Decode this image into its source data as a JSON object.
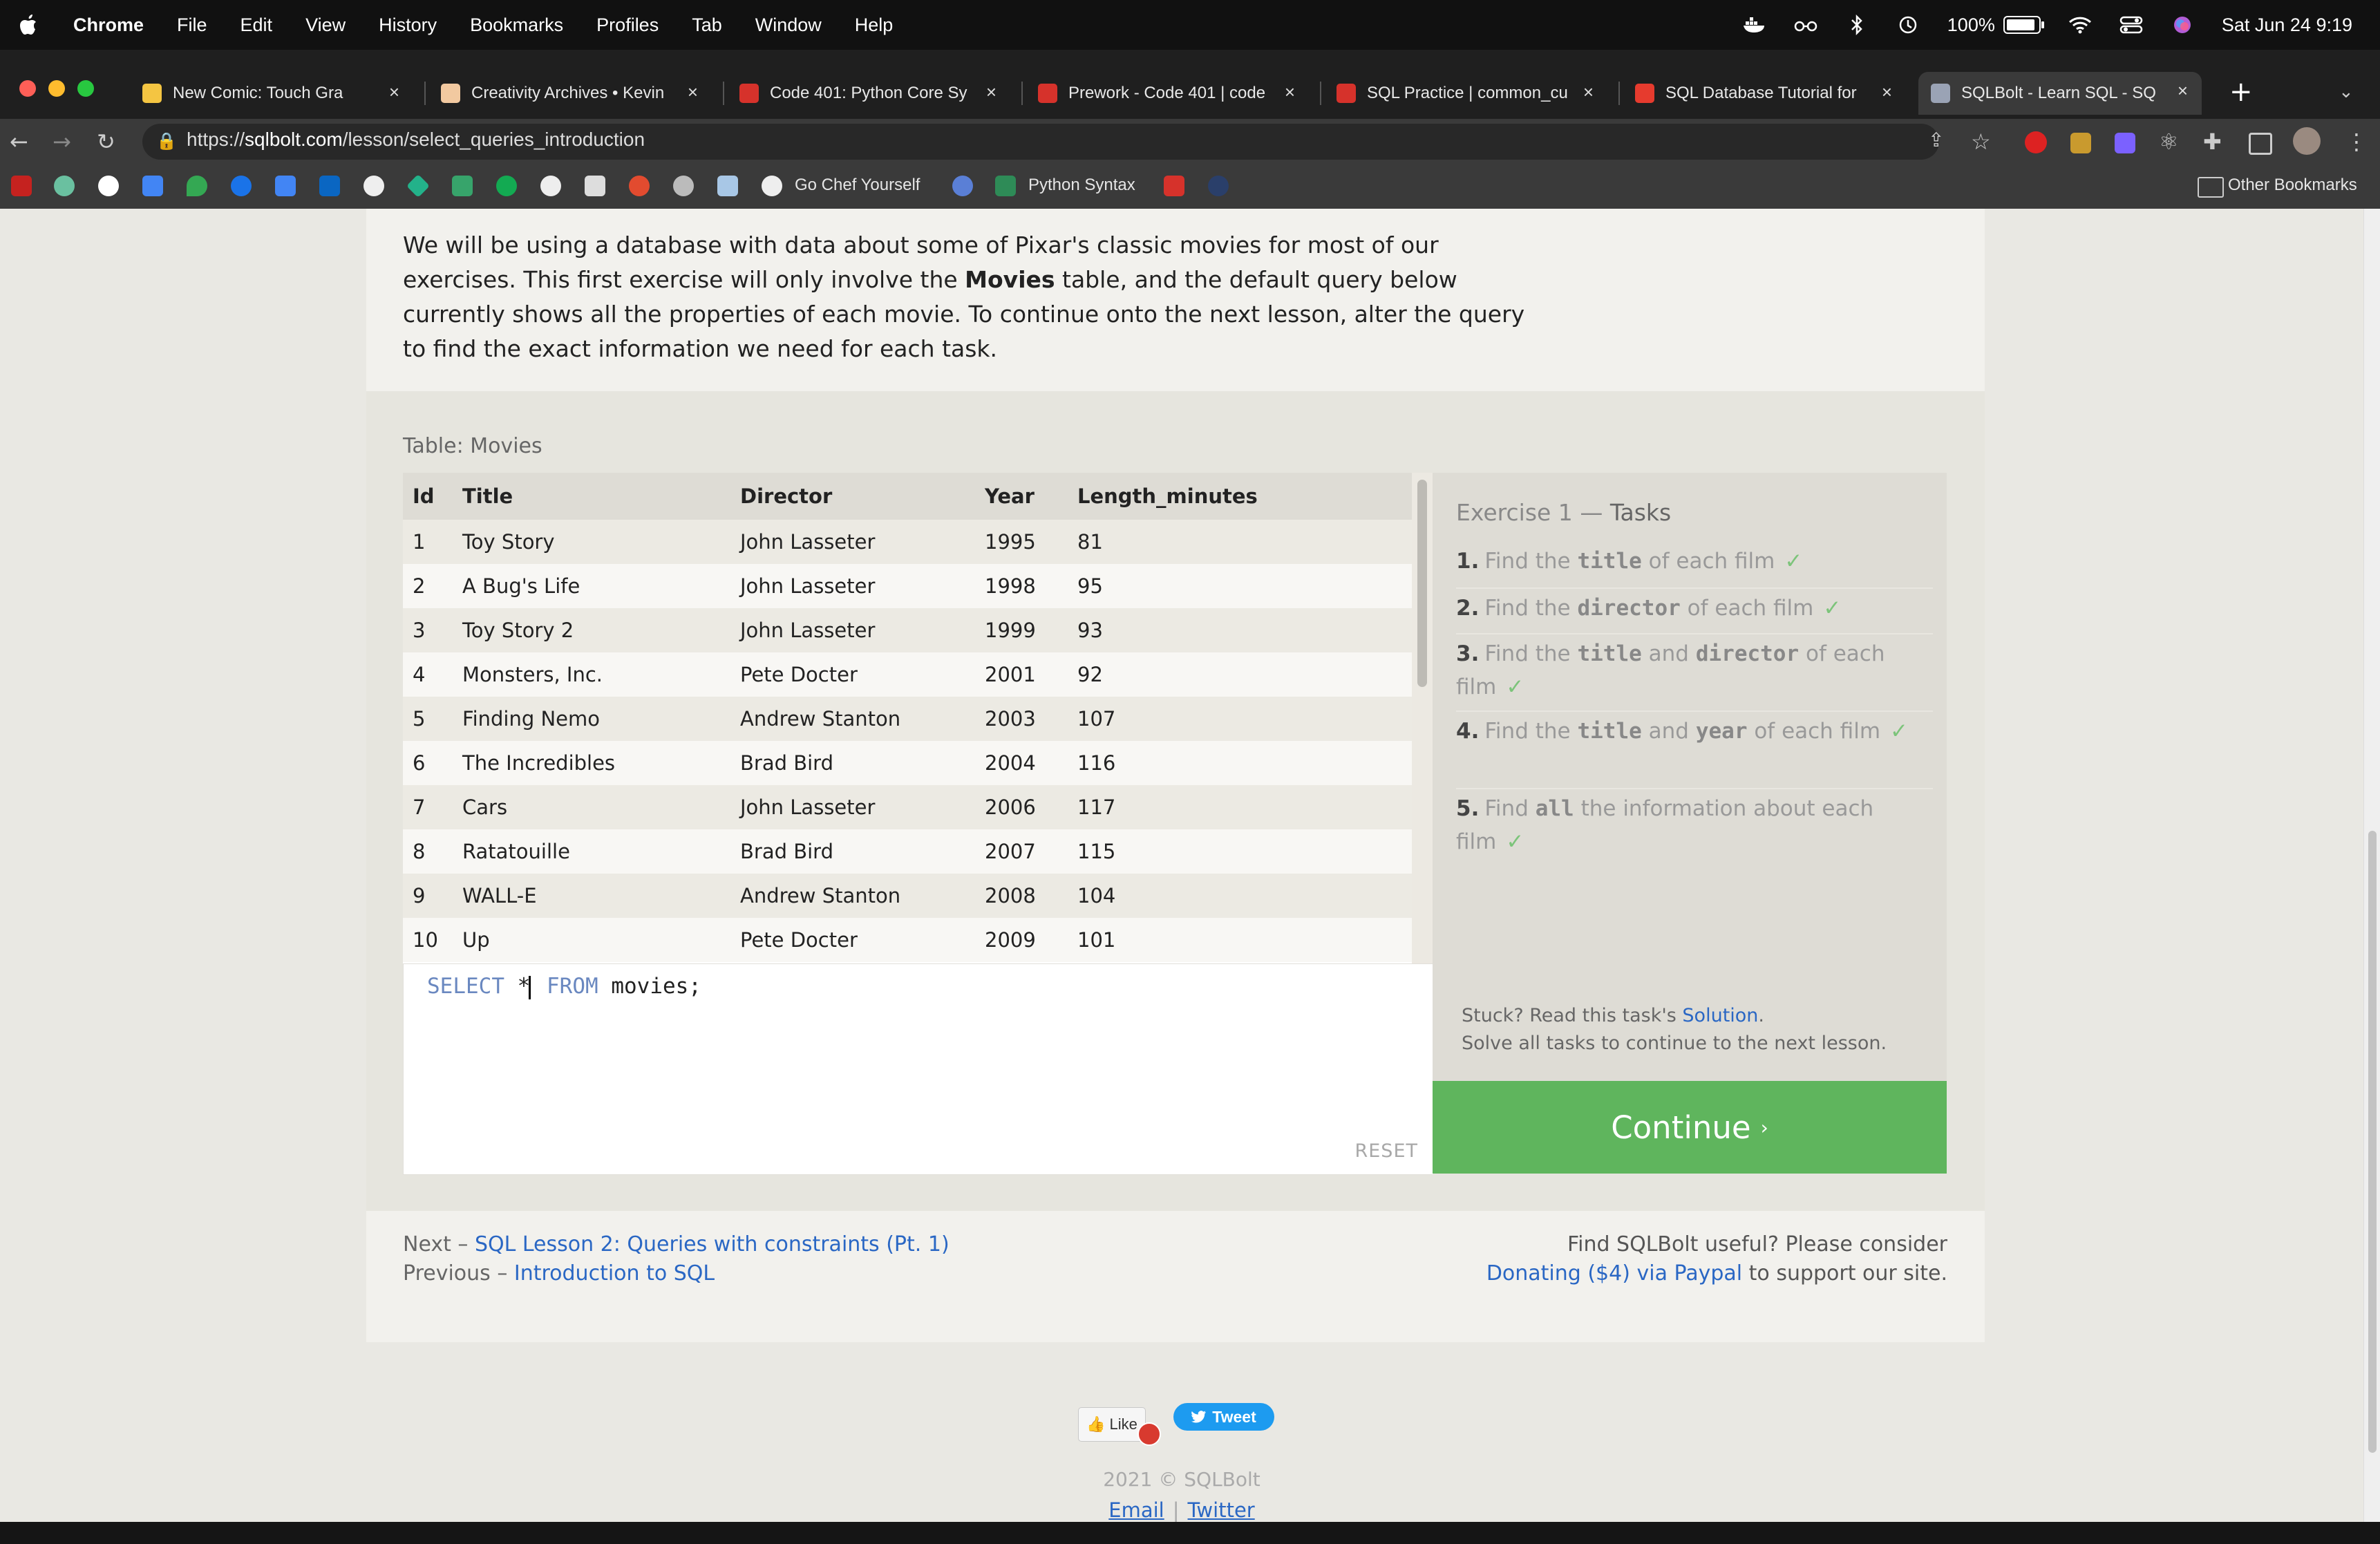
{
  "menubar": {
    "app": "Chrome",
    "items": [
      "File",
      "Edit",
      "View",
      "History",
      "Bookmarks",
      "Profiles",
      "Tab",
      "Window",
      "Help"
    ],
    "battery": "100%",
    "datetime": "Sat Jun 24  9:19"
  },
  "tabs": [
    {
      "label": "New Comic: Touch Gra",
      "icon": "gmail-icon",
      "color": "#f4c542"
    },
    {
      "label": "Creativity Archives • Kevin",
      "icon": "hand-icon",
      "color": "#f2c9a0"
    },
    {
      "label": "Code 401: Python Core Sy",
      "icon": "codefellows-icon",
      "color": "#d6322b"
    },
    {
      "label": "Prework - Code 401 | code",
      "icon": "codefellows-icon",
      "color": "#d6322b"
    },
    {
      "label": "SQL Practice | common_cu",
      "icon": "codefellows-icon",
      "color": "#d6322b"
    },
    {
      "label": "SQL Database Tutorial for",
      "icon": "video-icon",
      "color": "#e63b2e"
    },
    {
      "label": "SQLBolt - Learn SQL - SQ",
      "icon": "database-icon",
      "color": "#9aa3b5",
      "active": true
    }
  ],
  "address": {
    "host": "sqlbolt.com",
    "scheme": "https://",
    "path": "/lesson/select_queries_introduction"
  },
  "bookmarks": {
    "labeled": [
      "Go Chef Yourself",
      "Python Syntax"
    ],
    "other": "Other Bookmarks"
  },
  "lesson": {
    "intro_part1": "We will be using a database with data about some of Pixar's classic movies for most of our exercises. This first exercise will only involve the ",
    "intro_bold": "Movies",
    "intro_part2": " table, and the default query below currently shows all the properties of each movie. To continue onto the next lesson, alter the query to find the exact information we need for each task.",
    "table_caption": "Table: Movies",
    "columns": [
      "Id",
      "Title",
      "Director",
      "Year",
      "Length_minutes"
    ],
    "rows": [
      [
        "1",
        "Toy Story",
        "John Lasseter",
        "1995",
        "81"
      ],
      [
        "2",
        "A Bug's Life",
        "John Lasseter",
        "1998",
        "95"
      ],
      [
        "3",
        "Toy Story 2",
        "John Lasseter",
        "1999",
        "93"
      ],
      [
        "4",
        "Monsters, Inc.",
        "Pete Docter",
        "2001",
        "92"
      ],
      [
        "5",
        "Finding Nemo",
        "Andrew Stanton",
        "2003",
        "107"
      ],
      [
        "6",
        "The Incredibles",
        "Brad Bird",
        "2004",
        "116"
      ],
      [
        "7",
        "Cars",
        "John Lasseter",
        "2006",
        "117"
      ],
      [
        "8",
        "Ratatouille",
        "Brad Bird",
        "2007",
        "115"
      ],
      [
        "9",
        "WALL-E",
        "Andrew Stanton",
        "2008",
        "104"
      ],
      [
        "10",
        "Up",
        "Pete Docter",
        "2009",
        "101"
      ]
    ],
    "query": {
      "select": "SELECT",
      "star": "*",
      "from": "FROM",
      "table": "movies;"
    },
    "reset": "RESET",
    "tasks_title_a": "Exercise 1",
    "tasks_title_dash": "—",
    "tasks_title_b": "Tasks",
    "tasks": [
      {
        "num": "1.",
        "pre": "Find the ",
        "code": "title",
        "post": " of each film",
        "code2": "",
        "post2": "",
        "done": true
      },
      {
        "num": "2.",
        "pre": "Find the ",
        "code": "director",
        "post": " of each film",
        "code2": "",
        "post2": "",
        "done": true
      },
      {
        "num": "3.",
        "pre": "Find the ",
        "code": "title",
        "post": " and ",
        "code2": "director",
        "post2": " of each film",
        "done": true
      },
      {
        "num": "4.",
        "pre": "Find the ",
        "code": "title",
        "post": " and ",
        "code2": "year",
        "post2": " of each film",
        "done": true
      },
      {
        "num": "5.",
        "pre": "Find ",
        "code": "all",
        "post": " the information about each film",
        "code2": "",
        "post2": "",
        "done": true
      }
    ],
    "check": "✓",
    "stuck_pre": "Stuck? Read this task's ",
    "stuck_link": "Solution",
    "stuck_post": ".",
    "stuck_line2": "Solve all tasks to continue to the next lesson.",
    "continue": "Continue",
    "continue_chev": "›",
    "next_prefix": "Next – ",
    "next_link": "SQL Lesson 2: Queries with constraints (Pt. 1)",
    "prev_prefix": "Previous – ",
    "prev_link": "Introduction to SQL",
    "donate_line1": "Find SQLBolt useful? Please consider",
    "donate_link": "Donating ($4) via Paypal",
    "donate_post": " to support our site."
  },
  "footer": {
    "like": "Like",
    "tweet": "Tweet",
    "copyright": "2021 © SQLBolt",
    "email": "Email",
    "sep": "|",
    "twitter": "Twitter"
  },
  "colors": {
    "continue_green": "#5fb55d",
    "link_blue": "#2a67c4",
    "check_green": "#7cc47a"
  }
}
